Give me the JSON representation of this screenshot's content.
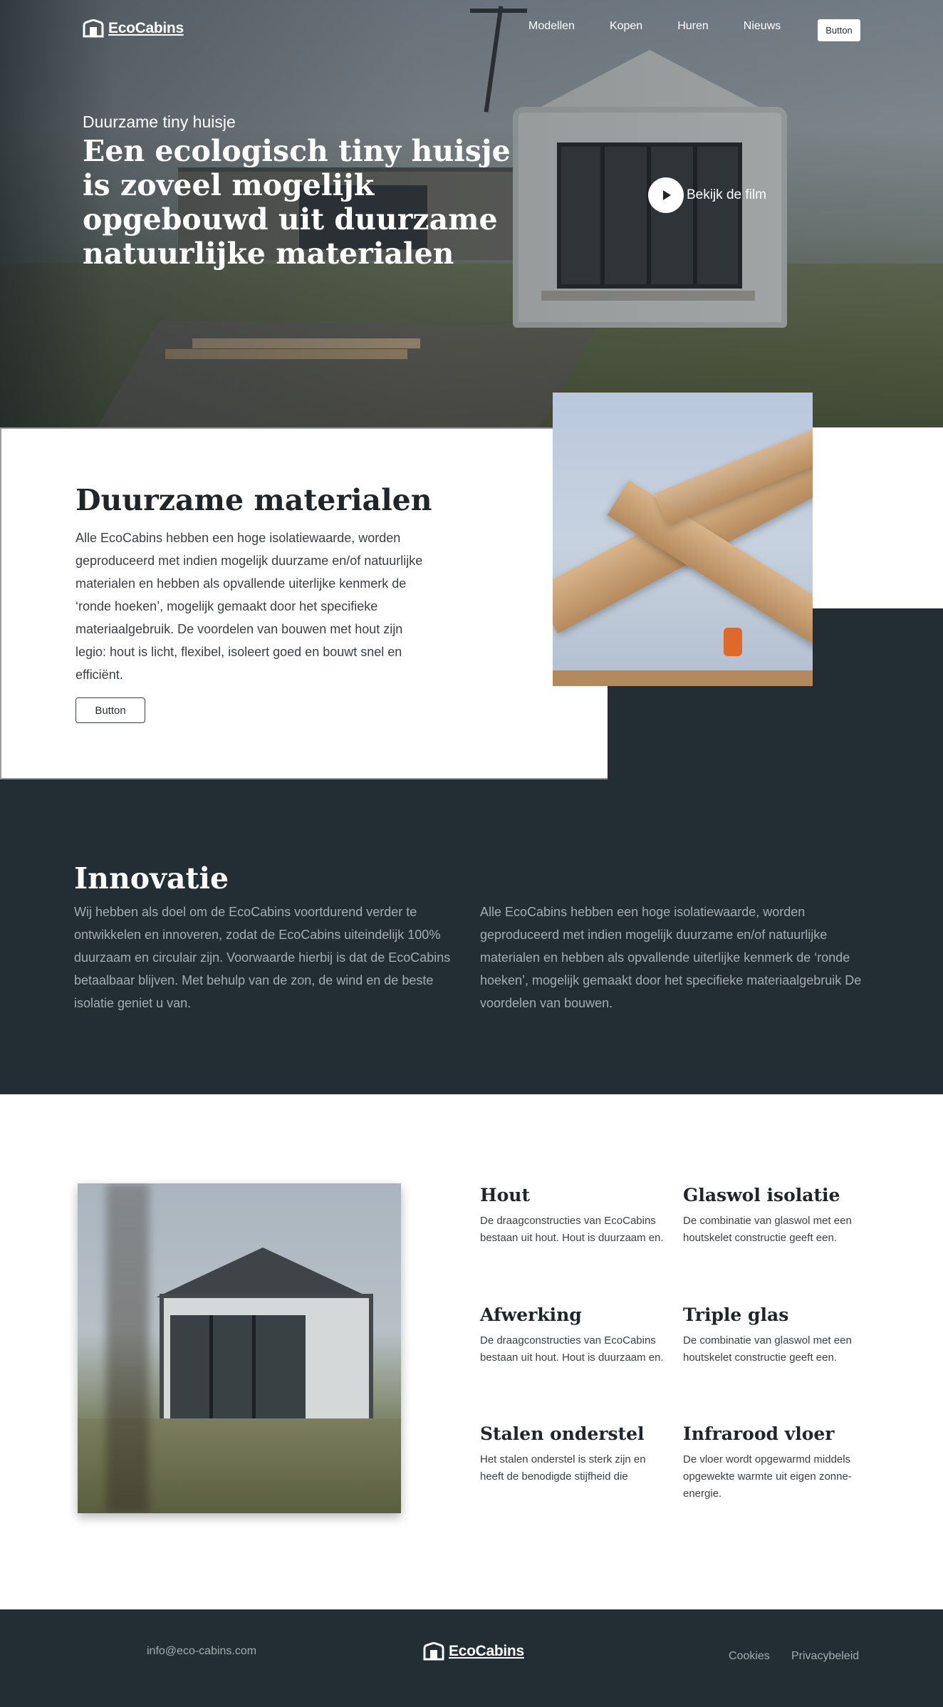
{
  "brand": {
    "name": "EcoCabins"
  },
  "nav": {
    "links": [
      "Modellen",
      "Kopen",
      "Huren",
      "Nieuws"
    ],
    "button_label": "Button"
  },
  "hero": {
    "kicker": "Duurzame tiny huisje",
    "title": "Een ecologisch tiny huisje is zoveel mogelijk opgebouwd uit duurzame natuurlijke materialen",
    "video_label": "Bekijk de film"
  },
  "materials": {
    "title": "Duurzame materialen",
    "text": "Alle EcoCabins hebben een hoge isolatiewaarde, worden geproduceerd met indien mogelijk duurzame en/of natuurlijke materialen en hebben als opvallende uiterlijke kenmerk de ‘ronde hoeken’, mogelijk gemaakt door het specifieke materiaalgebruik. De voordelen van bouwen met hout zijn legio: hout is licht, flexibel, isoleert goed en bouwt snel en efficiënt.",
    "button_label": "Button"
  },
  "innovation": {
    "title": "Innovatie",
    "left_text": "Wij hebben als doel om de EcoCabins voortdurend verder te ontwikkelen en innoveren, zodat de EcoCabins uiteindelijk 100% duurzaam en circulair zijn. Voorwaarde hierbij is dat de EcoCabins betaalbaar blijven. Met behulp van de zon, de wind en de beste isolatie geniet u van.",
    "right_text": "Alle EcoCabins hebben een hoge isolatiewaarde, worden geproduceerd met indien mogelijk duurzame en/of natuurlijke materialen en hebben als opvallende uiterlijke kenmerk de ‘ronde hoeken’, mogelijk gemaakt door het specifieke materiaalgebruik De voordelen van bouwen."
  },
  "features": [
    {
      "title": "Hout",
      "text": "De draagconstructies van EcoCabins bestaan uit hout. Hout is duurzaam en."
    },
    {
      "title": "Glaswol isolatie",
      "text": "De combinatie van glaswol met een houtskelet constructie geeft een."
    },
    {
      "title": "Afwerking",
      "text": "De draagconstructies van EcoCabins bestaan uit hout. Hout is duurzaam en."
    },
    {
      "title": "Triple glas",
      "text": "De combinatie van glaswol met een houtskelet constructie geeft een."
    },
    {
      "title": "Stalen onderstel",
      "text": "Het stalen onderstel is sterk zijn en heeft de benodigde stijfheid die"
    },
    {
      "title": "Infrarood vloer",
      "text": "De vloer wordt opgewarmd middels opgewekte warmte uit eigen zonne-energie."
    }
  ],
  "footer": {
    "email": "info@eco-cabins.com",
    "links": [
      "Cookies",
      "Privacybeleid"
    ]
  },
  "icons": {
    "logo": "cabin-logo-icon",
    "play": "play-icon"
  },
  "colors": {
    "dark": "#222e33",
    "white": "#ffffff",
    "muted_text": "#a5acb0"
  }
}
